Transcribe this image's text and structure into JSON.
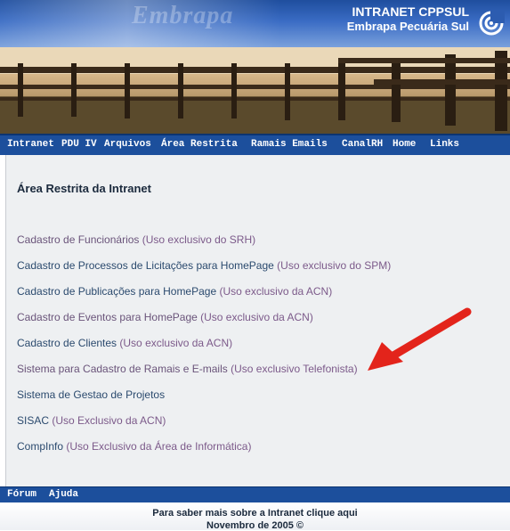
{
  "header": {
    "watermark": "Embrapa",
    "title_line1": "INTRANET CPPSUL",
    "title_line2": "Embrapa Pecuária Sul"
  },
  "topnav": {
    "items": [
      "Intranet",
      "PDU IV",
      "Arquivos",
      "Área Restrita",
      "Ramais Emails",
      "CanalRH",
      "Home",
      "Links"
    ]
  },
  "main": {
    "title": "Área Restrita da Intranet",
    "links": [
      {
        "name": "Cadastro de Funcionários",
        "note": " (Uso exclusivo do SRH)",
        "visited": true
      },
      {
        "name": "Cadastro de Processos de Licitações para HomePage",
        "note": " (Uso exclusivo do SPM)",
        "visited": false
      },
      {
        "name": "Cadastro de Publicações para HomePage",
        "note": " (Uso exclusivo da ACN)",
        "visited": false
      },
      {
        "name": "Cadastro de Eventos para HomePage",
        "note": " (Uso exclusivo da ACN)",
        "visited": true
      },
      {
        "name": "Cadastro de Clientes",
        "note": " (Uso exclusivo da ACN)",
        "visited": false
      },
      {
        "name": "Sistema para Cadastro de Ramais e E-mails",
        "note": " (Uso exclusivo Telefonista)",
        "visited": true
      },
      {
        "name": "Sistema de Gestao de Projetos",
        "note": "",
        "visited": false
      },
      {
        "name": "SISAC",
        "note": " (Uso Exclusivo da ACN)",
        "visited": false
      },
      {
        "name": "CompInfo",
        "note": " (Uso Exclusivo da Área de Informática)",
        "visited": false
      }
    ]
  },
  "bottomnav": {
    "items": [
      "Fórum",
      "Ajuda"
    ]
  },
  "footer": {
    "info_link": "Para saber mais sobre a Intranet clique aqui",
    "date": "Novembro de 2005 ©"
  },
  "colors": {
    "nav_bar": "#1c4f9c",
    "link": "#2b4a6e",
    "link_visited": "#6a547a",
    "annotation_arrow": "#e3241b"
  },
  "icons": {
    "logo": "embrapa-target-logo",
    "annotation": "red-arrow-icon"
  }
}
